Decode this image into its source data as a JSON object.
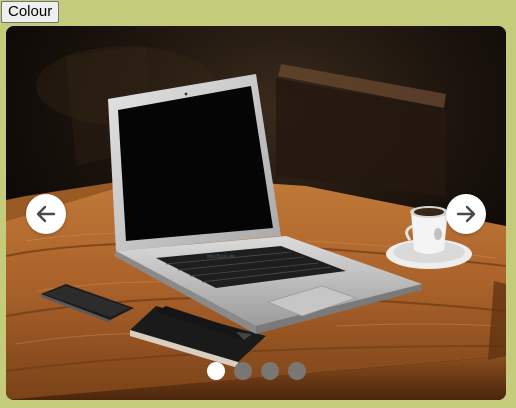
{
  "toolbar": {
    "colour_label": "Colour"
  },
  "carousel": {
    "slide_count": 4,
    "active_index": 0,
    "prev_icon": "arrow-left-icon",
    "next_icon": "arrow-right-icon",
    "colors": {
      "dot_active": "#ffffff",
      "dot_inactive": "#7a7672",
      "nav_bg": "#ffffff",
      "page_bg": "#c4cc7c"
    }
  }
}
